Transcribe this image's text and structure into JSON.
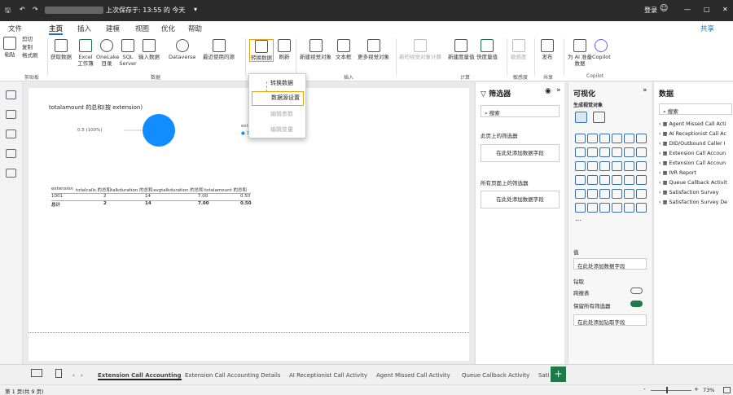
{
  "titlebar": {
    "autosave": "上次保存于: 13:55 的 今天",
    "signin": "登录",
    "minimize": "—",
    "maximize": "□",
    "close": "✕"
  },
  "ribbon_tabs": [
    "文件",
    "主页",
    "插入",
    "建模",
    "视图",
    "优化",
    "帮助"
  ],
  "share": "共享",
  "clipboard": {
    "cut": "剪切",
    "copy": "复制",
    "format": "格式刷",
    "paste": "粘贴",
    "group": "剪贴板"
  },
  "data_group": {
    "items": [
      "获取数据",
      "Excel 工作簿",
      "OneLake 目录",
      "SQL Server",
      "输入数据",
      "Dataverse",
      "最近使用的源"
    ],
    "group": "数据"
  },
  "queries": {
    "transform": "转换数据",
    "refresh": "刷新"
  },
  "insert_group": {
    "items": [
      "新建视觉对象",
      "文本框",
      "更多视觉对象"
    ],
    "group": "插入"
  },
  "calc_group": {
    "items": [
      "新的视觉对象计算",
      "新建度量值",
      "快度量值"
    ],
    "group": "计算"
  },
  "sens": {
    "label": "敏感度",
    "group": "敏感度"
  },
  "share_group": {
    "publish": "发布",
    "group": "共享"
  },
  "copilot_group": {
    "ai": "为 AI 准备数据",
    "copilot": "Copilot",
    "group": "Copilot"
  },
  "dropdown": [
    "转换数据",
    "数据源设置",
    "编辑参数",
    "编辑变量"
  ],
  "report": {
    "chart_title": "totalamount 的总和(按 extension)",
    "pie_label": "0.5 (100%)",
    "legend_title": "exte",
    "legend_item": "10",
    "table_headers": [
      "extension",
      "totalcalls 的总和",
      "talkduration 的总和",
      "avgtalkduration 的总和",
      "totalamount 的总和"
    ],
    "table_rows": [
      [
        "1001",
        "2",
        "14",
        "7.00",
        "0.50"
      ],
      [
        "总计",
        "2",
        "14",
        "7.00",
        "0.50"
      ]
    ]
  },
  "chart_data": {
    "type": "pie",
    "categories": [
      "1001"
    ],
    "values": [
      0.5
    ],
    "title": "totalamount 的总和(按 extension)"
  },
  "filters": {
    "title": "筛选器",
    "search": "搜索",
    "page_label": "此页上的筛选器",
    "page_add": "在此处添加数据字段",
    "all_label": "所有页面上的筛选器",
    "all_add": "在此处添加数据字段"
  },
  "viz": {
    "title": "可视化",
    "build": "生成视觉对象",
    "values": "值",
    "values_add": "在此处添加数据字段",
    "drill": "钻取",
    "cross": "跨报表",
    "keep": "保留所有筛选器",
    "drill_add": "在此处添加钻取字段"
  },
  "data": {
    "title": "数据",
    "search": "搜索",
    "tables": [
      "Agent Missed Call Acti",
      "AI Receptionist Call Ac",
      "DID/Outbound Caller I",
      "Extension Call Accoun",
      "Extension Call Accoun",
      "IVR Report",
      "Queue Callback Activit",
      "Satisfaction Survey",
      "Satisfaction Survey De"
    ]
  },
  "tabs": [
    "Extension Call Accounting",
    "Extension Call Accounting Details",
    "AI Receptionist Call Activity",
    "Agent Missed Call Activity",
    "Queue Callback Activity",
    "Sati"
  ],
  "status": {
    "page": "第 1 页(共 9 页)",
    "zoom": "73%"
  }
}
